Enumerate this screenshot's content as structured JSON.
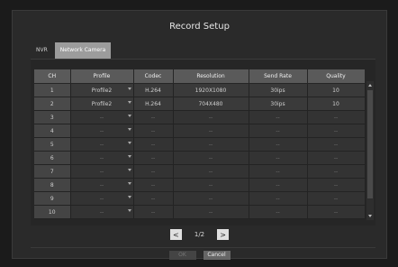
{
  "dialog": {
    "title": "Record Setup",
    "tabs": [
      "NVR",
      "Network Camera"
    ],
    "active_tab": "Network Camera"
  },
  "table": {
    "headers": [
      "CH",
      "Profile",
      "Codec",
      "Resolution",
      "Send Rate",
      "Quality"
    ],
    "rows": [
      {
        "ch": "1",
        "profile": "Profile2",
        "codec": "H.264",
        "resolution": "1920X1080",
        "send_rate": "30ips",
        "quality": "10"
      },
      {
        "ch": "2",
        "profile": "Profile2",
        "codec": "H.264",
        "resolution": "704X480",
        "send_rate": "30ips",
        "quality": "10"
      },
      {
        "ch": "3",
        "profile": "--",
        "codec": "--",
        "resolution": "--",
        "send_rate": "--",
        "quality": "--"
      },
      {
        "ch": "4",
        "profile": "--",
        "codec": "--",
        "resolution": "--",
        "send_rate": "--",
        "quality": "--"
      },
      {
        "ch": "5",
        "profile": "--",
        "codec": "--",
        "resolution": "--",
        "send_rate": "--",
        "quality": "--"
      },
      {
        "ch": "6",
        "profile": "--",
        "codec": "--",
        "resolution": "--",
        "send_rate": "--",
        "quality": "--"
      },
      {
        "ch": "7",
        "profile": "--",
        "codec": "--",
        "resolution": "--",
        "send_rate": "--",
        "quality": "--"
      },
      {
        "ch": "8",
        "profile": "--",
        "codec": "--",
        "resolution": "--",
        "send_rate": "--",
        "quality": "--"
      },
      {
        "ch": "9",
        "profile": "--",
        "codec": "--",
        "resolution": "--",
        "send_rate": "--",
        "quality": "--"
      },
      {
        "ch": "10",
        "profile": "--",
        "codec": "--",
        "resolution": "--",
        "send_rate": "--",
        "quality": "--"
      }
    ]
  },
  "pager": {
    "prev": "<",
    "page": "1/2",
    "next": ">"
  },
  "buttons": {
    "ok": "OK",
    "cancel": "Cancel"
  }
}
